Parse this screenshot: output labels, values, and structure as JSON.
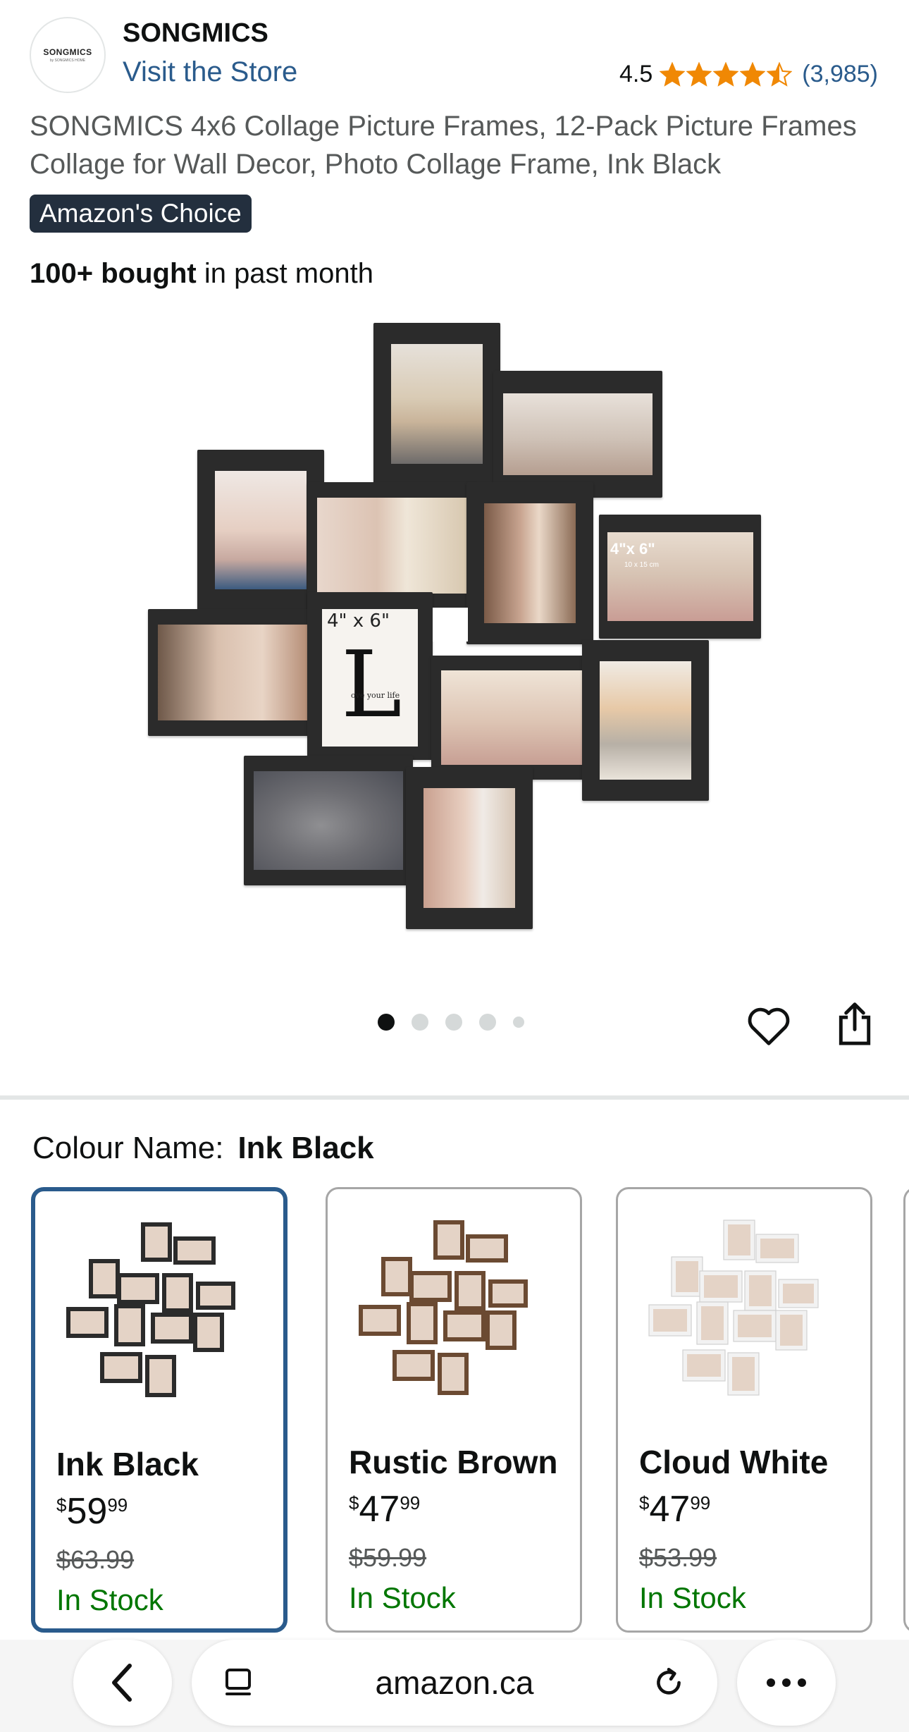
{
  "brand": {
    "logo_text": "SONGMICS",
    "logo_subtext": "by SONGMICS HOME",
    "name": "SONGMICS",
    "visit_store": "Visit the Store"
  },
  "rating": {
    "value": "4.5",
    "count": "(3,985)",
    "stars_filled": 4.5
  },
  "product": {
    "title": "SONGMICS 4x6 Collage Picture Frames, 12-Pack Picture Frames Collage for Wall Decor, Photo Collage Frame, Ink Black",
    "badge": "Amazon's Choice",
    "bought_bold": "100+ bought",
    "bought_rest": " in past month",
    "image_labels": {
      "size_label_main": "4\" x 6\"",
      "size_label_small": "4\"x 6\"",
      "size_label_cm": "10 x 15 cm",
      "print_text": "ove your life",
      "print_letter": "L"
    }
  },
  "carousel": {
    "image_count": 5,
    "active_index": 0
  },
  "icons": {
    "wishlist": "heart-icon",
    "share": "share-icon"
  },
  "colour": {
    "label": "Colour Name:",
    "selected": "Ink Black"
  },
  "variants": [
    {
      "name": "Ink Black",
      "currency": "$",
      "whole": "59",
      "fraction": "99",
      "was": "$63.99",
      "stock": "In Stock",
      "frame_color": "#2b2b2b"
    },
    {
      "name": "Rustic Brown",
      "currency": "$",
      "whole": "47",
      "fraction": "99",
      "was": "$59.99",
      "stock": "In Stock",
      "frame_color": "#6b4a32"
    },
    {
      "name": "Cloud White",
      "currency": "$",
      "whole": "47",
      "fraction": "99",
      "was": "$53.99",
      "stock": "In Stock",
      "frame_color": "#f2f2f2"
    }
  ],
  "browser": {
    "url": "amazon.ca"
  },
  "colors": {
    "link": "#2a5b8c",
    "star": "#f08804",
    "in_stock": "#007600",
    "badge_bg": "#232f3e",
    "selected_border": "#2a5b8c"
  }
}
